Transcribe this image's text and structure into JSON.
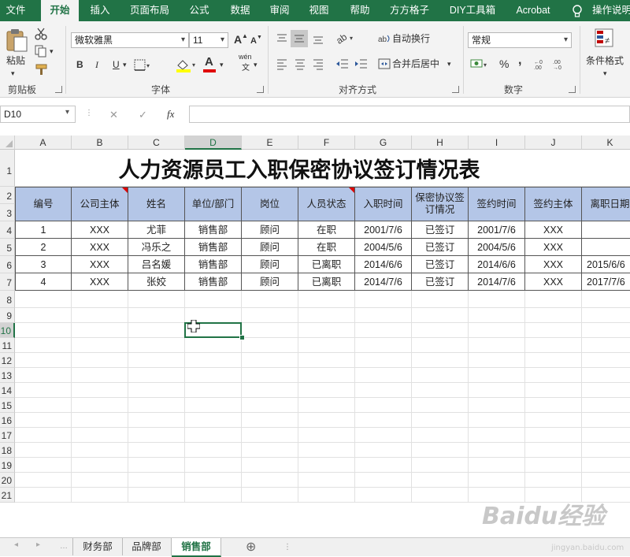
{
  "ribbon_tabs": [
    "文件",
    "开始",
    "插入",
    "页面布局",
    "公式",
    "数据",
    "审阅",
    "视图",
    "帮助",
    "方方格子",
    "DIY工具箱",
    "Acrobat",
    "操作说明"
  ],
  "active_tab": "开始",
  "clipboard": {
    "paste_label": "粘贴",
    "group_label": "剪贴板"
  },
  "font": {
    "name": "微软雅黑",
    "size": "11",
    "group_label": "字体",
    "bold": "B",
    "italic": "I",
    "underline": "U",
    "grow": "A",
    "shrink": "A",
    "font_color_letter": "A",
    "phonetic": "wén",
    "phonetic_sub": "文"
  },
  "alignment": {
    "wrap_label": "自动换行",
    "merge_label": "合并后居中",
    "group_label": "对齐方式"
  },
  "number": {
    "format": "常规",
    "percent": "%",
    "comma": ",",
    "group_label": "数字"
  },
  "styles": {
    "conditional_label": "条件格式"
  },
  "formula_bar": {
    "name_box": "D10",
    "cancel": "✕",
    "enter": "✓",
    "fx": "fx",
    "formula": ""
  },
  "columns": [
    "A",
    "B",
    "C",
    "D",
    "E",
    "F",
    "G",
    "H",
    "I",
    "J",
    "K"
  ],
  "rows": [
    "1",
    "2",
    "3",
    "4",
    "5",
    "6",
    "7",
    "8",
    "9",
    "10",
    "11",
    "12",
    "13",
    "14",
    "15",
    "16",
    "17",
    "18",
    "19",
    "20",
    "21"
  ],
  "title": "人力资源员工入职保密协议签订情况表",
  "headers": [
    "编号",
    "公司主体",
    "姓名",
    "单位/部门",
    "岗位",
    "人员状态",
    "入职时间",
    "保密协议签订情况",
    "签约时间",
    "签约主体",
    "离职日期"
  ],
  "records": [
    [
      "1",
      "XXX",
      "尤菲",
      "销售部",
      "顾问",
      "在职",
      "2001/7/6",
      "已签订",
      "2001/7/6",
      "XXX",
      ""
    ],
    [
      "2",
      "XXX",
      "冯乐之",
      "销售部",
      "顾问",
      "在职",
      "2004/5/6",
      "已签订",
      "2004/5/6",
      "XXX",
      ""
    ],
    [
      "3",
      "XXX",
      "吕名媛",
      "销售部",
      "顾问",
      "已离职",
      "2014/6/6",
      "已签订",
      "2014/6/6",
      "XXX",
      "2015/6/6"
    ],
    [
      "4",
      "XXX",
      "张姣",
      "销售部",
      "顾问",
      "已离职",
      "2014/7/6",
      "已签订",
      "2014/7/6",
      "XXX",
      "2017/7/6"
    ]
  ],
  "sheets": [
    "财务部",
    "品牌部",
    "销售部"
  ],
  "active_sheet": "销售部",
  "add_sheet": "⊕",
  "watermark": {
    "brand": "Baidu经验",
    "url": "jingyan.baidu.com"
  },
  "colors": {
    "excel_green": "#217346",
    "header_fill": "#b4c6e7",
    "comment_red": "#dd0000"
  }
}
